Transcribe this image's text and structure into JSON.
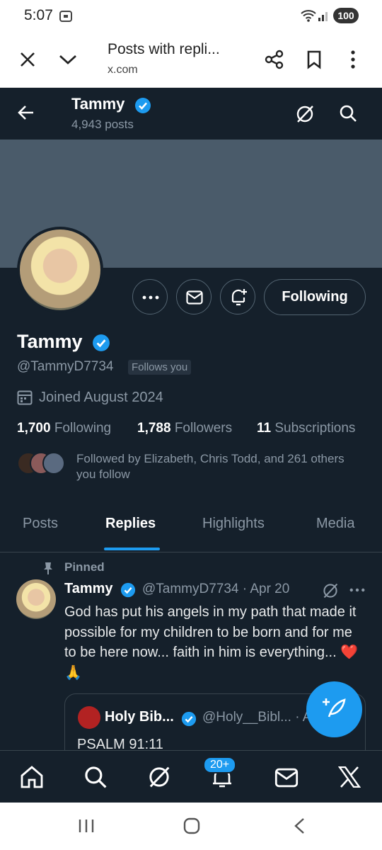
{
  "status_bar": {
    "time": "5:07",
    "battery": "100"
  },
  "browser": {
    "title": "Posts with repli...",
    "url": "x.com"
  },
  "header": {
    "name": "Tammy",
    "posts_count": "4,943 posts"
  },
  "profile": {
    "name": "Tammy",
    "handle": "@TammyD7734",
    "follows_you": "Follows you",
    "joined": "Joined August 2024",
    "following_btn": "Following",
    "stats": [
      {
        "value": "1,700",
        "label": "Following"
      },
      {
        "value": "1,788",
        "label": "Followers"
      },
      {
        "value": "11",
        "label": "Subscriptions"
      }
    ],
    "followed_by": "Followed by Elizabeth, Chris Todd, and 261 others you follow"
  },
  "tabs": [
    "Posts",
    "Replies",
    "Highlights",
    "Media"
  ],
  "tweet": {
    "pinned_label": "Pinned",
    "name": "Tammy",
    "meta": "@TammyD7734 · Apr 20",
    "text": "God has put his angels in my path that made it possible for my children to be born and for me to be here now... faith in him is everything...",
    "emojis": "❤️🙏",
    "quote": {
      "name": "Holy Bib...",
      "handle": "@Holy__Bibl... · A",
      "text": "PSALM 91:11"
    }
  },
  "bottom_nav": {
    "notifications_badge": "20+"
  },
  "colors": {
    "accent": "#1d9bf0",
    "background": "#15202b",
    "secondary_text": "#8b98a5"
  }
}
